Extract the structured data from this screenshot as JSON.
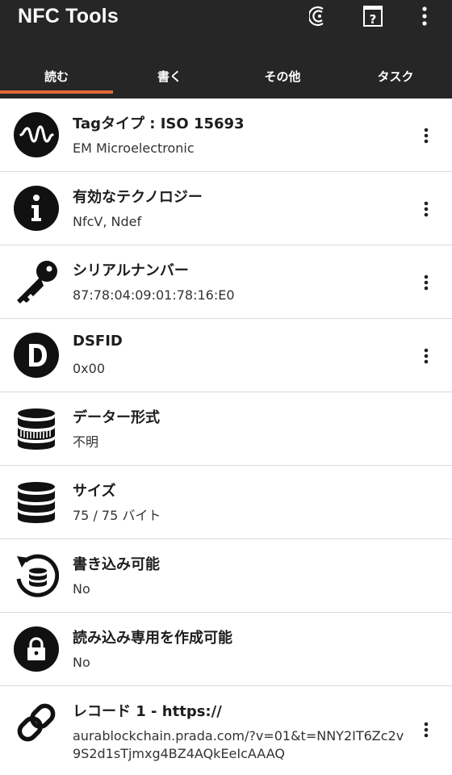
{
  "appbar": {
    "title": "NFC Tools",
    "actions": [
      {
        "icon": "nfc-scan-icon"
      },
      {
        "icon": "help-icon"
      },
      {
        "icon": "more-vert-icon"
      }
    ]
  },
  "tabs": [
    {
      "label": "読む",
      "active": true
    },
    {
      "label": "書く",
      "active": false
    },
    {
      "label": "その他",
      "active": false
    },
    {
      "label": "タスク",
      "active": false
    }
  ],
  "items": [
    {
      "icon": "waveform-icon",
      "title": "Tagタイプ : ISO 15693",
      "value": "EM Microelectronic",
      "has_menu": true
    },
    {
      "icon": "info-icon",
      "title": "有効なテクノロジー",
      "value": "NfcV, Ndef",
      "has_menu": true
    },
    {
      "icon": "key-icon",
      "title": "シリアルナンバー",
      "value": "87:78:04:09:01:78:16:E0",
      "has_menu": true
    },
    {
      "icon": "d-letter-icon",
      "title": "DSFID",
      "value": "0x00",
      "has_menu": true
    },
    {
      "icon": "database-format-icon",
      "title": "データー形式",
      "value": "不明",
      "has_menu": false
    },
    {
      "icon": "database-icon",
      "title": "サイズ",
      "value": "75 / 75 バイト",
      "has_menu": false
    },
    {
      "icon": "rewrite-icon",
      "title": "書き込み可能",
      "value": "No",
      "has_menu": false
    },
    {
      "icon": "lock-icon",
      "title": "読み込み専用を作成可能",
      "value": "No",
      "has_menu": false
    },
    {
      "icon": "link-icon",
      "title": "レコード 1 - https://",
      "value": "aurablockchain.prada.com/?v=01&t=NNY2IT6Zc2v9S2d1sTjmxg4BZ4AQkEeIcAAAQ",
      "has_menu": true
    }
  ],
  "colors": {
    "appbar": "#262626",
    "tab_indicator": "#e4683a",
    "divider": "#d9d9d9"
  }
}
